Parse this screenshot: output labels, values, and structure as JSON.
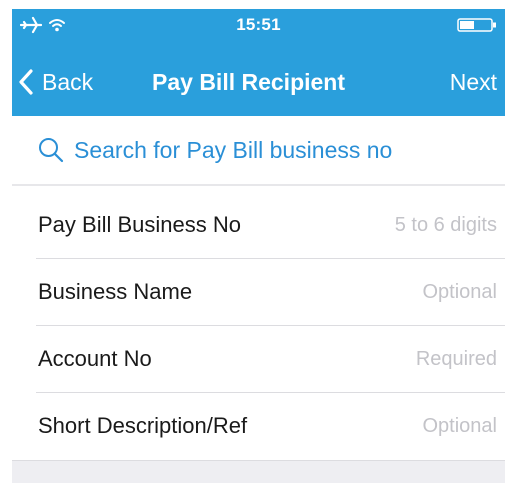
{
  "status_bar": {
    "time": "15:51",
    "icons": [
      "airplane-icon",
      "wifi-icon",
      "battery-icon"
    ]
  },
  "nav": {
    "back_label": "Back",
    "title": "Pay Bill Recipient",
    "next_label": "Next",
    "back_icon": "chevron-left-icon"
  },
  "search": {
    "placeholder": "Search for Pay Bill business no",
    "icon": "search-icon"
  },
  "form": {
    "rows": [
      {
        "label": "Pay Bill Business No",
        "placeholder": "5 to 6 digits",
        "value": ""
      },
      {
        "label": "Business Name",
        "placeholder": "Optional",
        "value": ""
      },
      {
        "label": "Account No",
        "placeholder": "Required",
        "value": ""
      },
      {
        "label": "Short Description/Ref",
        "placeholder": "Optional",
        "value": ""
      }
    ]
  },
  "colors": {
    "accent": "#2a9fdc",
    "link": "#2a8fd6",
    "placeholder": "#c3c3c8",
    "footer_bg": "#eeeef2"
  }
}
